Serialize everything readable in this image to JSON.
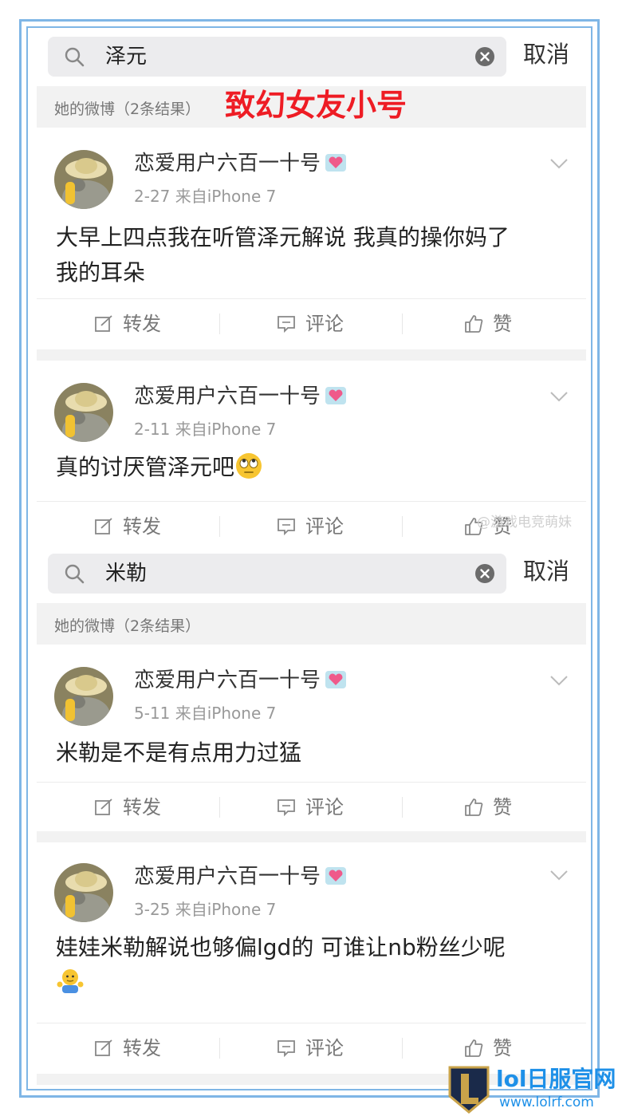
{
  "sections": [
    {
      "search": {
        "query": "泽元",
        "cancel": "取消"
      },
      "results_label": "她的微博（2条结果）",
      "annotation": "致幻女友小号",
      "posts": [
        {
          "username": "恋爱用户六百一十号",
          "date_source": "2-27  来自iPhone 7",
          "text_lines": [
            "大早上四点我在听管泽元解说 我真的操你妈了",
            "我的耳朵"
          ],
          "actions": {
            "repost": "转发",
            "comment": "评论",
            "like": "赞"
          }
        },
        {
          "username": "恋爱用户六百一十号",
          "date_source": "2-11  来自iPhone 7",
          "text_lines": [
            "真的讨厌管泽元吧"
          ],
          "emoji": "eye-roll-emoji",
          "actions": {
            "repost": "转发",
            "comment": "评论",
            "like": "赞"
          }
        }
      ]
    },
    {
      "search": {
        "query": "米勒",
        "cancel": "取消"
      },
      "results_label": "她的微博（2条结果）",
      "posts": [
        {
          "username": "恋爱用户六百一十号",
          "date_source": "5-11  来自iPhone 7",
          "text_lines": [
            "米勒是不是有点用力过猛"
          ],
          "actions": {
            "repost": "转发",
            "comment": "评论",
            "like": "赞"
          }
        },
        {
          "username": "恋爱用户六百一十号",
          "date_source": "3-25  来自iPhone 7",
          "text_lines": [
            "娃娃米勒解说也够偏lgd的 可谁让nb粉丝少呢"
          ],
          "emoji": "shrug-emoji",
          "actions": {
            "repost": "转发",
            "comment": "评论",
            "like": "赞"
          }
        }
      ]
    }
  ],
  "watermark": "@游戏电竞萌妹",
  "logo": {
    "title": "lol日服官网",
    "url": "www.lolrf.com"
  },
  "colors": {
    "frame": "#7fb6e6",
    "annotation": "#ee1c24",
    "logo": "#1e90e8",
    "badge": "#ef5a8a"
  },
  "icons": [
    "search-icon",
    "clear-icon",
    "chevron-down-icon",
    "repost-icon",
    "comment-icon",
    "like-icon",
    "heart-badge-icon"
  ]
}
